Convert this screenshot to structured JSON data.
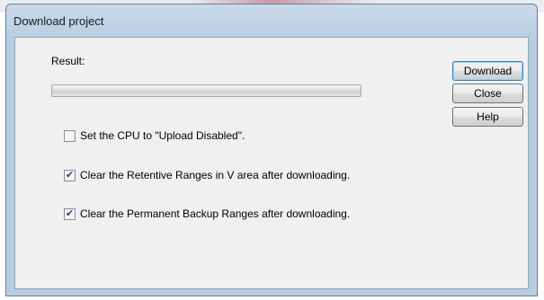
{
  "window": {
    "title": "Download project"
  },
  "result": {
    "label": "Result:",
    "progress_fraction": 0.0
  },
  "buttons": {
    "download": "Download",
    "close": "Close",
    "help": "Help"
  },
  "options": [
    {
      "label": "Set the CPU to \"Upload Disabled\".",
      "checked": false
    },
    {
      "label": "Clear the Retentive Ranges in V area after downloading.",
      "checked": true
    },
    {
      "label": "Clear the Permanent Backup Ranges after downloading.",
      "checked": true
    }
  ]
}
